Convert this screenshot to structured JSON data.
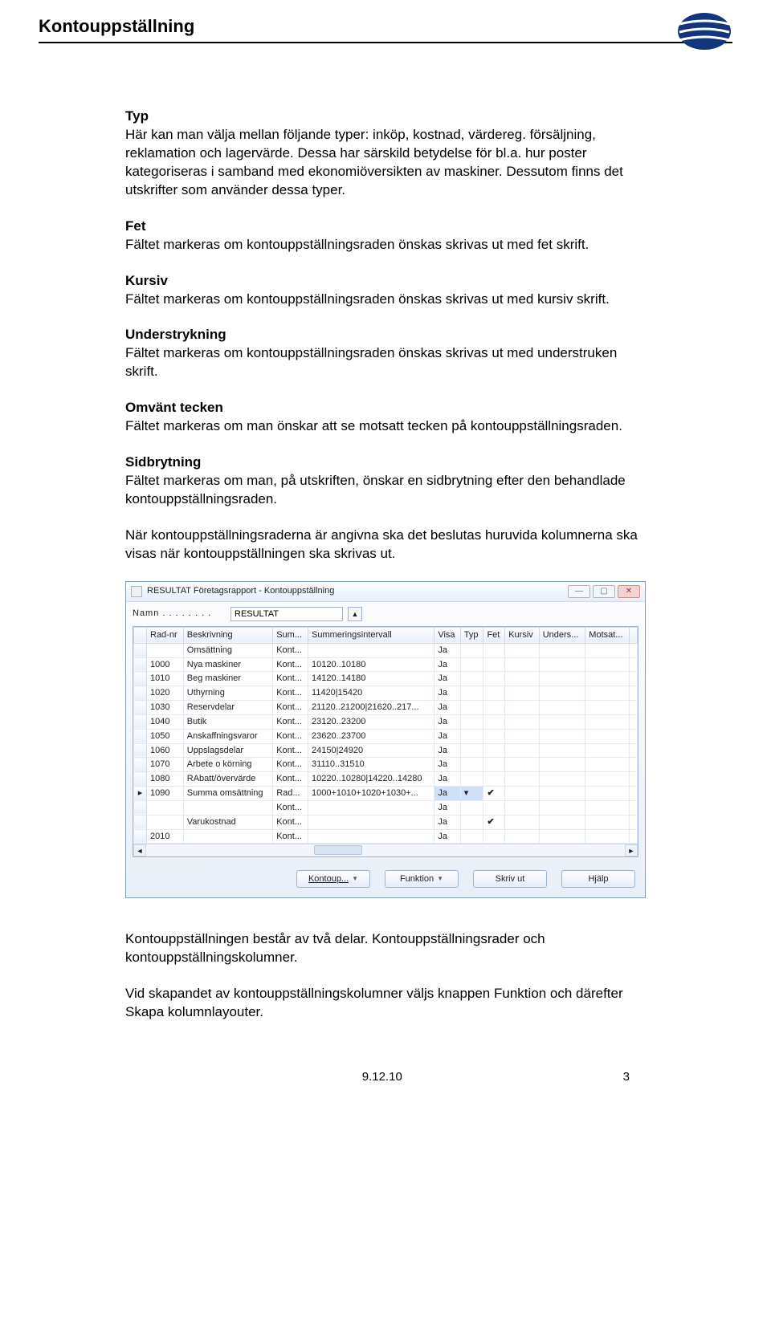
{
  "header": {
    "title": "Kontouppställning"
  },
  "sections": {
    "typ": {
      "title": "Typ",
      "body": "Här kan man välja mellan följande typer: inköp, kostnad, värdereg. försäljning, reklamation och lagervärde. Dessa har särskild betydelse för bl.a. hur poster kategoriseras i samband med ekonomiöversikten av maskiner. Dessutom finns det utskrifter som använder dessa typer."
    },
    "fet": {
      "title": "Fet",
      "body": "Fältet markeras om kontouppställningsraden önskas skrivas ut med fet skrift."
    },
    "kursiv": {
      "title": "Kursiv",
      "body": "Fältet markeras om kontouppställningsraden önskas skrivas ut med kursiv skrift."
    },
    "under": {
      "title": "Understrykning",
      "body": "Fältet markeras om kontouppställningsraden önskas skrivas ut med understruken skrift."
    },
    "omv": {
      "title": "Omvänt tecken",
      "body": "Fältet markeras om man önskar att se motsatt tecken på kontouppställningsraden."
    },
    "sid": {
      "title": "Sidbrytning",
      "body": "Fältet markeras om man, på utskriften, önskar en sidbrytning efter den behandlade kontouppställningsraden."
    },
    "tail1": "När kontouppställningsraderna är angivna ska det beslutas huruvida kolumnerna ska visas när kontouppställningen ska skrivas ut.",
    "tail2": "Kontouppställningen består av två delar. Kontouppställningsrader och kontouppställningskolumner.",
    "tail3": "Vid skapandet av kontouppställningskolumner väljs knappen Funktion och därefter Skapa kolumnlayouter."
  },
  "window": {
    "title": "RESULTAT Företagsrapport - Kontouppställning",
    "nameLabel": "Namn . . . . . . . .",
    "nameValue": "RESULTAT",
    "columns": [
      "",
      "Rad-nr",
      "Beskrivning",
      "Sum...",
      "Summeringsintervall",
      "Visa",
      "Typ",
      "Fet",
      "Kursiv",
      "Unders...",
      "Motsat...",
      ""
    ],
    "rows": [
      {
        "m": "",
        "r": "",
        "b": "Omsättning",
        "s": "Kont...",
        "i": "",
        "v": "Ja",
        "t": "",
        "f": "",
        "k": "",
        "u": "",
        "mo": ""
      },
      {
        "m": "",
        "r": "1000",
        "b": "Nya maskiner",
        "s": "Kont...",
        "i": "10120..10180",
        "v": "Ja",
        "t": "",
        "f": "",
        "k": "",
        "u": "",
        "mo": ""
      },
      {
        "m": "",
        "r": "1010",
        "b": "Beg maskiner",
        "s": "Kont...",
        "i": "14120..14180",
        "v": "Ja",
        "t": "",
        "f": "",
        "k": "",
        "u": "",
        "mo": ""
      },
      {
        "m": "",
        "r": "1020",
        "b": "Uthyrning",
        "s": "Kont...",
        "i": "11420|15420",
        "v": "Ja",
        "t": "",
        "f": "",
        "k": "",
        "u": "",
        "mo": ""
      },
      {
        "m": "",
        "r": "1030",
        "b": "Reservdelar",
        "s": "Kont...",
        "i": "21120..21200|21620..217...",
        "v": "Ja",
        "t": "",
        "f": "",
        "k": "",
        "u": "",
        "mo": ""
      },
      {
        "m": "",
        "r": "1040",
        "b": "Butik",
        "s": "Kont...",
        "i": "23120..23200",
        "v": "Ja",
        "t": "",
        "f": "",
        "k": "",
        "u": "",
        "mo": ""
      },
      {
        "m": "",
        "r": "1050",
        "b": "Anskaffningsvaror",
        "s": "Kont...",
        "i": "23620..23700",
        "v": "Ja",
        "t": "",
        "f": "",
        "k": "",
        "u": "",
        "mo": ""
      },
      {
        "m": "",
        "r": "1060",
        "b": "Uppslagsdelar",
        "s": "Kont...",
        "i": "24150|24920",
        "v": "Ja",
        "t": "",
        "f": "",
        "k": "",
        "u": "",
        "mo": ""
      },
      {
        "m": "",
        "r": "1070",
        "b": "Arbete o körning",
        "s": "Kont...",
        "i": "31110..31510",
        "v": "Ja",
        "t": "",
        "f": "",
        "k": "",
        "u": "",
        "mo": ""
      },
      {
        "m": "",
        "r": "1080",
        "b": "RAbatt/övervärde",
        "s": "Kont...",
        "i": "10220..10280|14220..14280",
        "v": "Ja",
        "t": "",
        "f": "",
        "k": "",
        "u": "",
        "mo": ""
      },
      {
        "m": "▸",
        "r": "1090",
        "b": "Summa omsättning",
        "s": "Rad...",
        "i": "1000+1010+1020+1030+...",
        "v": "Ja",
        "t": "▾",
        "f": "✔",
        "k": "",
        "u": "",
        "mo": "",
        "sel": true
      },
      {
        "m": "",
        "r": "",
        "b": "",
        "s": "Kont...",
        "i": "",
        "v": "Ja",
        "t": "",
        "f": "",
        "k": "",
        "u": "",
        "mo": ""
      },
      {
        "m": "",
        "r": "",
        "b": "Varukostnad",
        "s": "Kont...",
        "i": "",
        "v": "Ja",
        "t": "",
        "f": "✔",
        "k": "",
        "u": "",
        "mo": ""
      },
      {
        "m": "",
        "r": "2010",
        "b": "",
        "s": "Kont...",
        "i": "",
        "v": "Ja",
        "t": "",
        "f": "",
        "k": "",
        "u": "",
        "mo": ""
      }
    ],
    "buttons": {
      "kontoup": "Kontoup...",
      "funktion": "Funktion",
      "skrivut": "Skriv ut",
      "hjalp": "Hjälp"
    }
  },
  "footer": {
    "date": "9.12.10",
    "page": "3"
  }
}
